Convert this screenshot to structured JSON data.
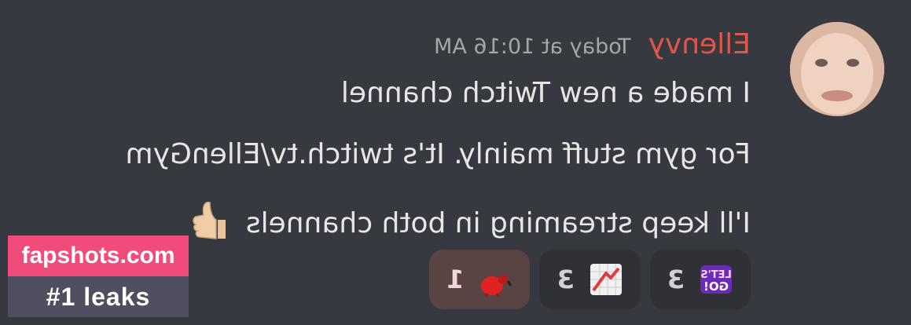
{
  "message": {
    "username": "Ellenvy",
    "timestamp": "Today at 10:16 AM",
    "lines": [
      "I made a new Twitch channel",
      "For gym stuff mainly. It's twitch.tv/EllenGym",
      "I'll keep streaming in both channels"
    ],
    "inline_emoji": "thumbs-up-icon"
  },
  "reactions": [
    {
      "emoji": "lets-go-icon",
      "count": "3",
      "active": false
    },
    {
      "emoji": "chart-decreasing-icon",
      "count": "3",
      "active": false
    },
    {
      "emoji": "red-figure-sticker-icon",
      "count": "1",
      "active": true
    }
  ],
  "watermark": {
    "site": "fapshots.com",
    "tagline": "#1 leaks"
  },
  "colors": {
    "background": "#36393f",
    "username": "#e2564a",
    "reaction_bg": "#2f3136",
    "reaction_active_bg": "#5a4343",
    "watermark_pink": "#f14b79",
    "watermark_gray": "#4f4f60"
  }
}
